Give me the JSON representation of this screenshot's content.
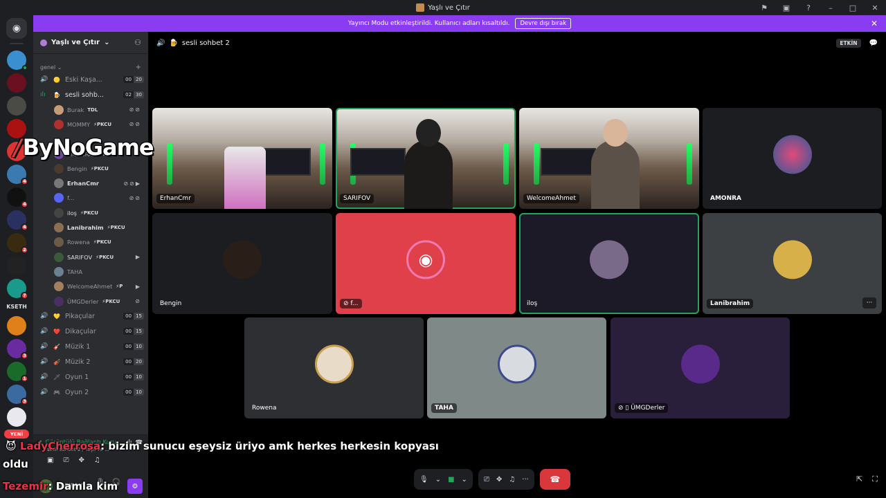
{
  "titlebar": {
    "title": "Yaşlı ve Çıtır"
  },
  "banner": {
    "message": "Yayıncı Modu etkinleştirildi. Kullanıcı adları kısaltıldı.",
    "button": "Devre dışı bırak"
  },
  "rail": {
    "badges": [
      "4",
      "4",
      "4",
      "2",
      "7",
      "3",
      "1",
      "3"
    ],
    "kseth": "KSETH",
    "new_label": "YENİ"
  },
  "guild": {
    "name": "Yaşlı ve Çıtır"
  },
  "category": "genel",
  "channels": [
    {
      "name": "Eski Kaşa...",
      "emoji": "🟡",
      "a": "00",
      "b": "20"
    },
    {
      "name": "sesli sohb...",
      "emoji": "🍺",
      "a": "02",
      "b": "30",
      "active": true
    }
  ],
  "voice_users": [
    {
      "name": "Burak",
      "tag": "TDL",
      "color": "#c79a7a"
    },
    {
      "name": "MOMMY",
      "tag": "⚡PKCU",
      "color": "#b03030"
    },
    {
      "name": "AMONRA",
      "tag": "⚡PKCU",
      "color": "#6d4a9c"
    },
    {
      "name": "Bengin",
      "tag": "⚡PKCU",
      "color": "#4a3a30"
    },
    {
      "name": "ErhanCmr",
      "tag": "",
      "color": "#777"
    },
    {
      "name": "f...",
      "tag": "",
      "color": "#5865f2"
    },
    {
      "name": "iloş",
      "tag": "⚡PKCU",
      "color": "#444"
    },
    {
      "name": "Lanibrahim",
      "tag": "⚡PKCU",
      "color": "#8a7050"
    },
    {
      "name": "Rowena",
      "tag": "⚡PKCU",
      "color": "#6b5a4a"
    },
    {
      "name": "SARIFOV",
      "tag": "⚡PKCU",
      "color": "#3a5a3a"
    },
    {
      "name": "TAHA",
      "tag": "",
      "color": "#6b8090"
    },
    {
      "name": "WelcomeAhmet",
      "tag": "⚡P",
      "color": "#a08060"
    },
    {
      "name": "ÜMGDerler",
      "tag": "⚡PKCU",
      "color": "#4a3060"
    }
  ],
  "more_channels": [
    {
      "name": "Pikaçular",
      "emoji": "💛",
      "a": "00",
      "b": "15"
    },
    {
      "name": "Dikaçular",
      "emoji": "❤️",
      "a": "00",
      "b": "15"
    },
    {
      "name": "Müzik 1",
      "emoji": "🎸",
      "a": "00",
      "b": "10"
    },
    {
      "name": "Müzik 2",
      "emoji": "🎻",
      "a": "00",
      "b": "20"
    },
    {
      "name": "Oyun 1",
      "emoji": "🗡",
      "a": "00",
      "b": "10"
    },
    {
      "name": "Oyun 2",
      "emoji": "🎮",
      "a": "00",
      "b": "10"
    }
  ],
  "voice_panel": {
    "status": "Görüntülü Bağlantı Kuru",
    "sub": "sesli sohbet 2 / Yaşlı ve ..."
  },
  "user_panel": {
    "name": "SARIFOV"
  },
  "vc_header": {
    "channel": "sesli sohbet 2",
    "pill": "ETKİN"
  },
  "tiles": [
    {
      "label": "ErhanCmr"
    },
    {
      "label": "SARIFOV"
    },
    {
      "label": "WelcomeAhmet"
    },
    {
      "label": "AMONRA"
    },
    {
      "label": "Bengin"
    },
    {
      "label": "f..."
    },
    {
      "label": "iloş"
    },
    {
      "label": "Lanibrahim"
    },
    {
      "label": "Rowena"
    },
    {
      "label": "TAHA"
    },
    {
      "label": "ÜMGDerler"
    }
  ],
  "overlay": {
    "watermark": "ByNoGame",
    "chat1_name": "LadyCherrosa",
    "chat1_text": ": bizim sunucu eşeysiz üriyo amk herkes herkesin kopyası",
    "chat1_cont": "oldu",
    "chat2_name": "Tezemir",
    "chat2_text": ": Damla kim"
  }
}
